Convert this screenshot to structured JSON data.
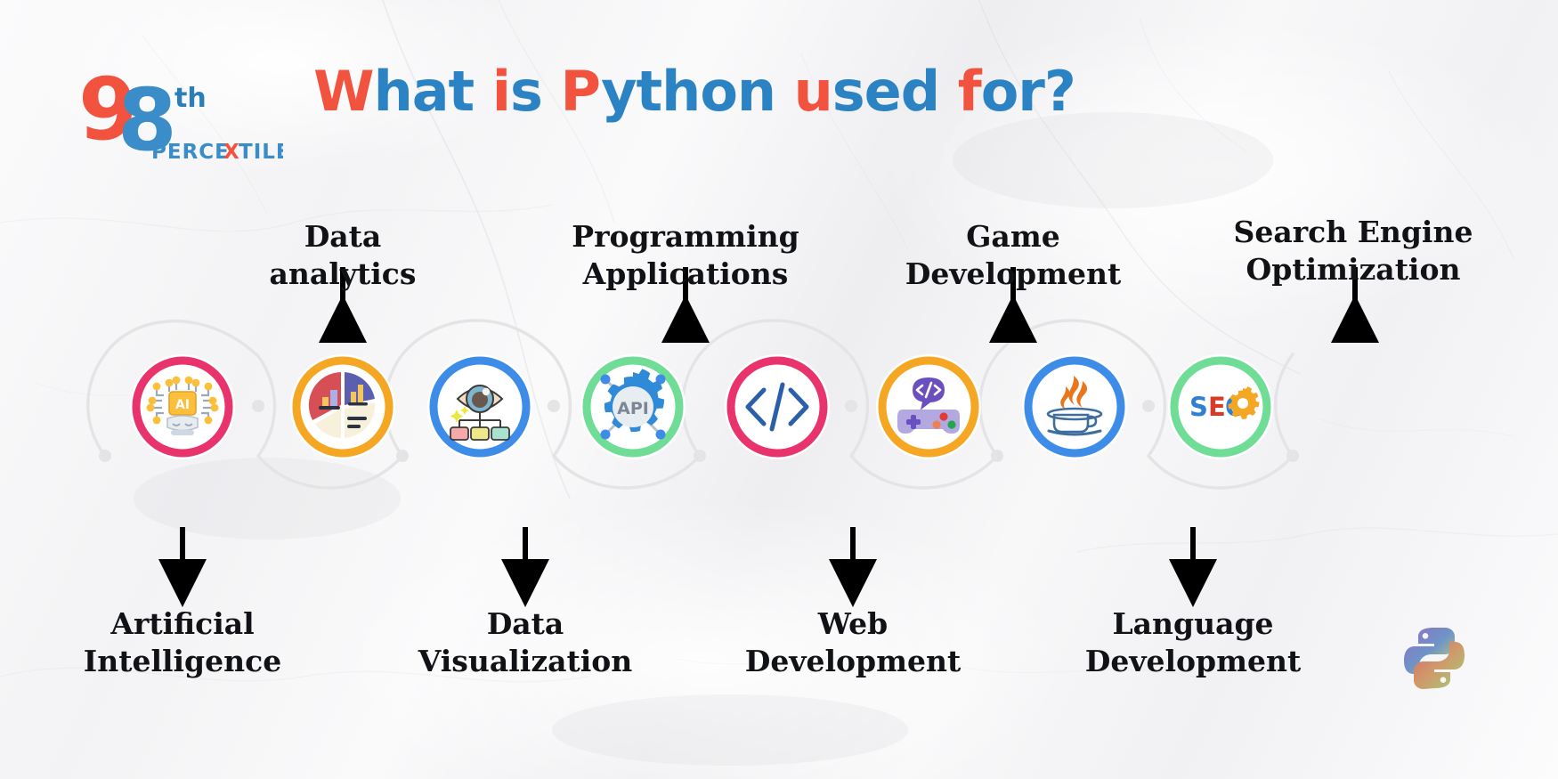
{
  "brand": {
    "logo_number_first": "9",
    "logo_number_second": "8",
    "logo_suffix": "th",
    "logo_word": "PERCENTILE",
    "logo_red": "#f2533f",
    "logo_blue": "#2b83c4"
  },
  "header": {
    "title_full": "What is Python used for?",
    "title_segments": [
      {
        "text": "W",
        "color": "red"
      },
      {
        "text": "hat ",
        "color": "blue"
      },
      {
        "text": "i",
        "color": "red"
      },
      {
        "text": "s ",
        "color": "blue"
      },
      {
        "text": "P",
        "color": "red"
      },
      {
        "text": "ython ",
        "color": "blue"
      },
      {
        "text": "u",
        "color": "red"
      },
      {
        "text": "sed ",
        "color": "blue"
      },
      {
        "text": "f",
        "color": "red"
      },
      {
        "text": "or?",
        "color": "blue"
      }
    ],
    "accent_red": "#f2533f",
    "accent_blue": "#2b83c4"
  },
  "diagram": {
    "connector_color": "#e3e3e5",
    "arrow_color": "#000000",
    "nodes": [
      {
        "id": "artificial-intelligence",
        "label": "Artificial\nIntelligence",
        "icon": "ai-robot-chip-icon",
        "ring_color": "#e8336d",
        "label_position": "below"
      },
      {
        "id": "data-analytics",
        "label": "Data\nanalytics",
        "icon": "pie-bar-chart-icon",
        "ring_color": "#f5a623",
        "label_position": "above"
      },
      {
        "id": "data-visualization",
        "label": "Data\nVisualization",
        "icon": "eye-hierarchy-icon",
        "ring_color": "#3d8ce8",
        "label_position": "below"
      },
      {
        "id": "programming-applications",
        "label": "Programming\nApplications",
        "icon": "api-gear-icon",
        "ring_color": "#6fdd96",
        "label_position": "above",
        "icon_text": "API"
      },
      {
        "id": "web-development",
        "label": "Web\nDevelopment",
        "icon": "code-brackets-icon",
        "ring_color": "#e8336d",
        "label_position": "below"
      },
      {
        "id": "game-development",
        "label": "Game\nDevelopment",
        "icon": "gamepad-code-icon",
        "ring_color": "#f5a623",
        "label_position": "above"
      },
      {
        "id": "language-development",
        "label": "Language\nDevelopment",
        "icon": "java-coffee-cup-icon",
        "ring_color": "#3d8ce8",
        "label_position": "below"
      },
      {
        "id": "search-engine-optimization",
        "label": "Search Engine\nOptimization",
        "icon": "seo-gear-icon",
        "ring_color": "#6fdd96",
        "label_position": "above",
        "icon_text": "SEO"
      }
    ]
  },
  "footer": {
    "python_logo": "python-logo-icon"
  }
}
